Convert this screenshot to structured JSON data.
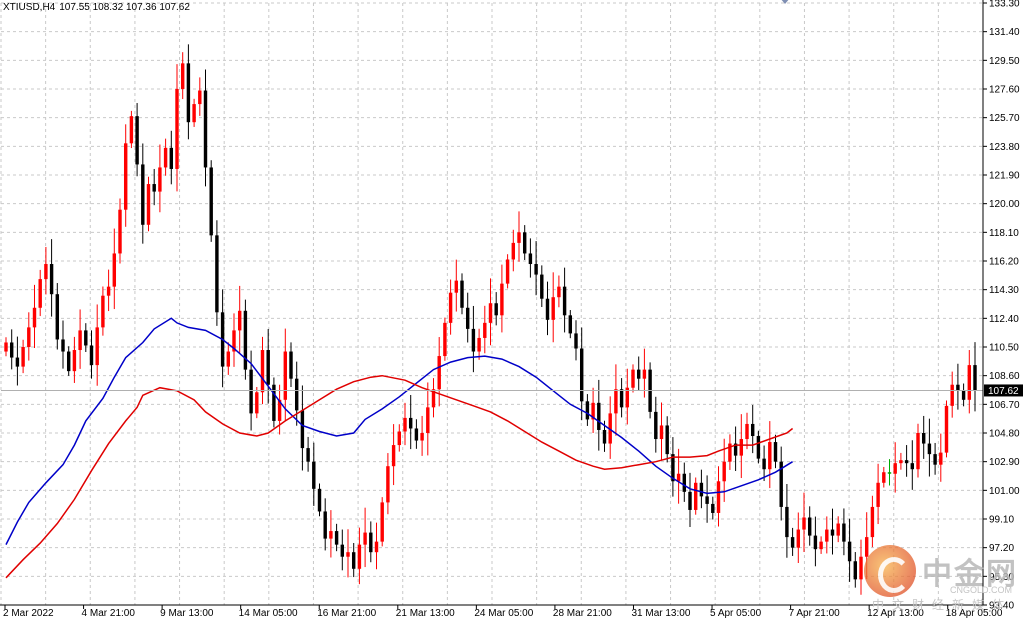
{
  "header": {
    "symbol": "XTIUSD,H4",
    "ohlc": "107.55 108.32 107.36 107.62"
  },
  "current_price_label": "107.62",
  "watermark": {
    "cn": "中金网",
    "en": "CNGOLD.COM",
    "sub": "中文财经新媒体"
  },
  "colors": {
    "bull": "#ff0000",
    "bear": "#000000",
    "doji": "#00aa00",
    "ma_fast": "#0000c8",
    "ma_slow": "#e00000",
    "grid": "#c9c9c9",
    "axis": "#000000",
    "price_line": "#b0b0b0"
  },
  "chart_data": {
    "type": "candlestick",
    "symbol": "XTIUSD",
    "timeframe": "H4",
    "ylim": [
      93.4,
      133.3
    ],
    "grid": true,
    "y_ticks": [
      "133.30",
      "131.40",
      "129.50",
      "127.60",
      "125.70",
      "123.80",
      "121.90",
      "120.00",
      "118.10",
      "116.20",
      "114.30",
      "112.40",
      "110.50",
      "108.60",
      "106.70",
      "104.80",
      "102.90",
      "101.00",
      "99.10",
      "97.20",
      "95.30",
      "93.40"
    ],
    "x_ticks": [
      "2 Mar 2022",
      "4 Mar 21:00",
      "9 Mar 13:00",
      "14 Mar 05:00",
      "16 Mar 21:00",
      "21 Mar 13:00",
      "24 Mar 05:00",
      "28 Mar 21:00",
      "31 Mar 13:00",
      "5 Apr 05:00",
      "7 Apr 21:00",
      "12 Apr 13:00",
      "18 Apr 05:00"
    ],
    "last_price": 107.62,
    "closes": [
      110.8,
      109.8,
      109.2,
      110.5,
      111.8,
      113.1,
      115.0,
      116.0,
      114.0,
      111.0,
      110.2,
      108.9,
      110.3,
      111.6,
      110.6,
      109.3,
      111.8,
      113.9,
      114.5,
      116.7,
      119.6,
      124.0,
      125.8,
      122.6,
      118.6,
      121.3,
      120.8,
      122.4,
      123.7,
      122.3,
      127.6,
      129.3,
      125.4,
      126.6,
      127.5,
      122.4,
      117.9,
      112.8,
      109.2,
      110.2,
      111.6,
      112.9,
      109.0,
      106.1,
      107.5,
      110.3,
      108.0,
      105.6,
      107.0,
      110.2,
      108.4,
      106.3,
      103.8,
      102.9,
      101.1,
      99.6,
      97.8,
      98.3,
      97.4,
      96.6,
      96.9,
      95.8,
      97.4,
      98.2,
      96.9,
      97.6,
      100.2,
      102.6,
      104.0,
      104.9,
      105.8,
      105.1,
      104.3,
      104.8,
      106.5,
      107.7,
      109.9,
      112.1,
      114.1,
      114.9,
      113.1,
      111.7,
      110.2,
      111.1,
      112.1,
      113.4,
      112.6,
      114.7,
      116.3,
      117.4,
      118.1,
      116.7,
      116.0,
      115.3,
      113.7,
      112.3,
      113.8,
      114.5,
      112.6,
      111.4,
      110.4,
      106.9,
      105.7,
      106.8,
      105.0,
      104.1,
      106.1,
      107.7,
      106.5,
      107.8,
      109.0,
      108.4,
      109.0,
      106.2,
      104.4,
      105.3,
      103.4,
      101.6,
      102.1,
      100.9,
      99.7,
      101.5,
      100.6,
      100.1,
      99.5,
      101.6,
      102.9,
      104.1,
      103.3,
      104.4,
      105.4,
      104.6,
      103.1,
      102.4,
      104.2,
      102.9,
      99.9,
      97.9,
      97.2,
      98.4,
      99.2,
      98.0,
      97.1,
      97.6,
      98.4,
      98.0,
      98.8,
      97.6,
      96.3,
      95.1,
      96.6,
      97.9,
      99.9,
      101.5,
      102.2,
      102.1,
      102.8,
      103.0,
      102.8,
      102.4,
      104.8,
      104.1,
      103.4,
      102.7,
      103.5,
      106.6,
      108.0,
      107.6,
      107.0,
      109.3,
      107.6
    ],
    "series": [
      {
        "indicator": "moving-average-fast",
        "color": "#0000c8",
        "points": [
          [
            0,
            97.4
          ],
          [
            2,
            98.9
          ],
          [
            4,
            100.2
          ],
          [
            7,
            101.5
          ],
          [
            10,
            102.7
          ],
          [
            12,
            104.0
          ],
          [
            14,
            105.6
          ],
          [
            17,
            107.1
          ],
          [
            19,
            108.5
          ],
          [
            21,
            109.8
          ],
          [
            24,
            110.8
          ],
          [
            26,
            111.7
          ],
          [
            29,
            112.4
          ],
          [
            30,
            112.1
          ],
          [
            32,
            111.8
          ],
          [
            35,
            111.6
          ],
          [
            38,
            111.0
          ],
          [
            40,
            110.4
          ],
          [
            43,
            109.4
          ],
          [
            46,
            107.9
          ],
          [
            49,
            106.4
          ],
          [
            52,
            105.3
          ],
          [
            55,
            104.9
          ],
          [
            58,
            104.6
          ],
          [
            61,
            104.8
          ],
          [
            63,
            105.7
          ],
          [
            66,
            106.4
          ],
          [
            69,
            107.2
          ],
          [
            72,
            108.1
          ],
          [
            75,
            109.0
          ],
          [
            78,
            109.5
          ],
          [
            81,
            109.8
          ],
          [
            84,
            109.9
          ],
          [
            87,
            109.7
          ],
          [
            90,
            109.2
          ],
          [
            93,
            108.5
          ],
          [
            96,
            107.6
          ],
          [
            99,
            106.7
          ],
          [
            102,
            106.1
          ],
          [
            105,
            105.3
          ],
          [
            108,
            104.5
          ],
          [
            111,
            103.6
          ],
          [
            114,
            102.6
          ],
          [
            117,
            101.8
          ],
          [
            120,
            101.1
          ],
          [
            123,
            100.8
          ],
          [
            126,
            100.9
          ],
          [
            129,
            101.3
          ],
          [
            132,
            101.7
          ],
          [
            135,
            102.2
          ],
          [
            138,
            102.9
          ]
        ]
      },
      {
        "indicator": "moving-average-slow",
        "color": "#e00000",
        "points": [
          [
            0,
            95.2
          ],
          [
            3,
            96.4
          ],
          [
            6,
            97.5
          ],
          [
            9,
            98.8
          ],
          [
            12,
            100.4
          ],
          [
            15,
            102.3
          ],
          [
            18,
            104.1
          ],
          [
            21,
            105.6
          ],
          [
            23,
            106.5
          ],
          [
            24,
            107.3
          ],
          [
            27,
            107.8
          ],
          [
            30,
            107.6
          ],
          [
            33,
            107.0
          ],
          [
            35,
            106.2
          ],
          [
            38,
            105.4
          ],
          [
            41,
            104.8
          ],
          [
            44,
            104.6
          ],
          [
            46,
            104.8
          ],
          [
            49,
            105.6
          ],
          [
            52,
            106.3
          ],
          [
            55,
            107.0
          ],
          [
            58,
            107.7
          ],
          [
            61,
            108.2
          ],
          [
            64,
            108.5
          ],
          [
            66,
            108.6
          ],
          [
            70,
            108.3
          ],
          [
            73,
            107.8
          ],
          [
            76,
            107.4
          ],
          [
            79,
            107.0
          ],
          [
            82,
            106.6
          ],
          [
            85,
            106.2
          ],
          [
            88,
            105.6
          ],
          [
            91,
            104.9
          ],
          [
            94,
            104.2
          ],
          [
            97,
            103.6
          ],
          [
            100,
            103.0
          ],
          [
            103,
            102.6
          ],
          [
            105,
            102.4
          ],
          [
            108,
            102.5
          ],
          [
            111,
            102.7
          ],
          [
            114,
            102.9
          ],
          [
            117,
            103.2
          ],
          [
            120,
            103.2
          ],
          [
            123,
            103.3
          ],
          [
            125,
            103.6
          ],
          [
            128,
            104.0
          ],
          [
            131,
            104.0
          ],
          [
            134,
            104.4
          ],
          [
            137,
            104.8
          ],
          [
            138,
            105.1
          ]
        ]
      }
    ]
  }
}
